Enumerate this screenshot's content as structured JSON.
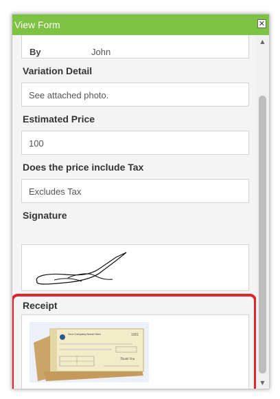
{
  "window": {
    "title": "View Form",
    "close_glyph": "✕",
    "accent_color": "#7dc242",
    "highlight_color": "#e0242b"
  },
  "fields": {
    "by": {
      "label": "By",
      "value": "John"
    },
    "variation_detail": {
      "label": "Variation Detail",
      "value": "See attached photo."
    },
    "estimated_price": {
      "label": "Estimated Price",
      "value": "100"
    },
    "price_tax": {
      "label": "Does the price include Tax",
      "value": "Excludes Tax"
    },
    "signature": {
      "label": "Signature"
    },
    "receipt": {
      "label": "Receipt",
      "image_text": {
        "company": "Your Company Name Here",
        "number": "1001",
        "thanks": "Thank You"
      }
    }
  },
  "scrollbar": {
    "up_glyph": "▲",
    "down_glyph": "▼"
  }
}
